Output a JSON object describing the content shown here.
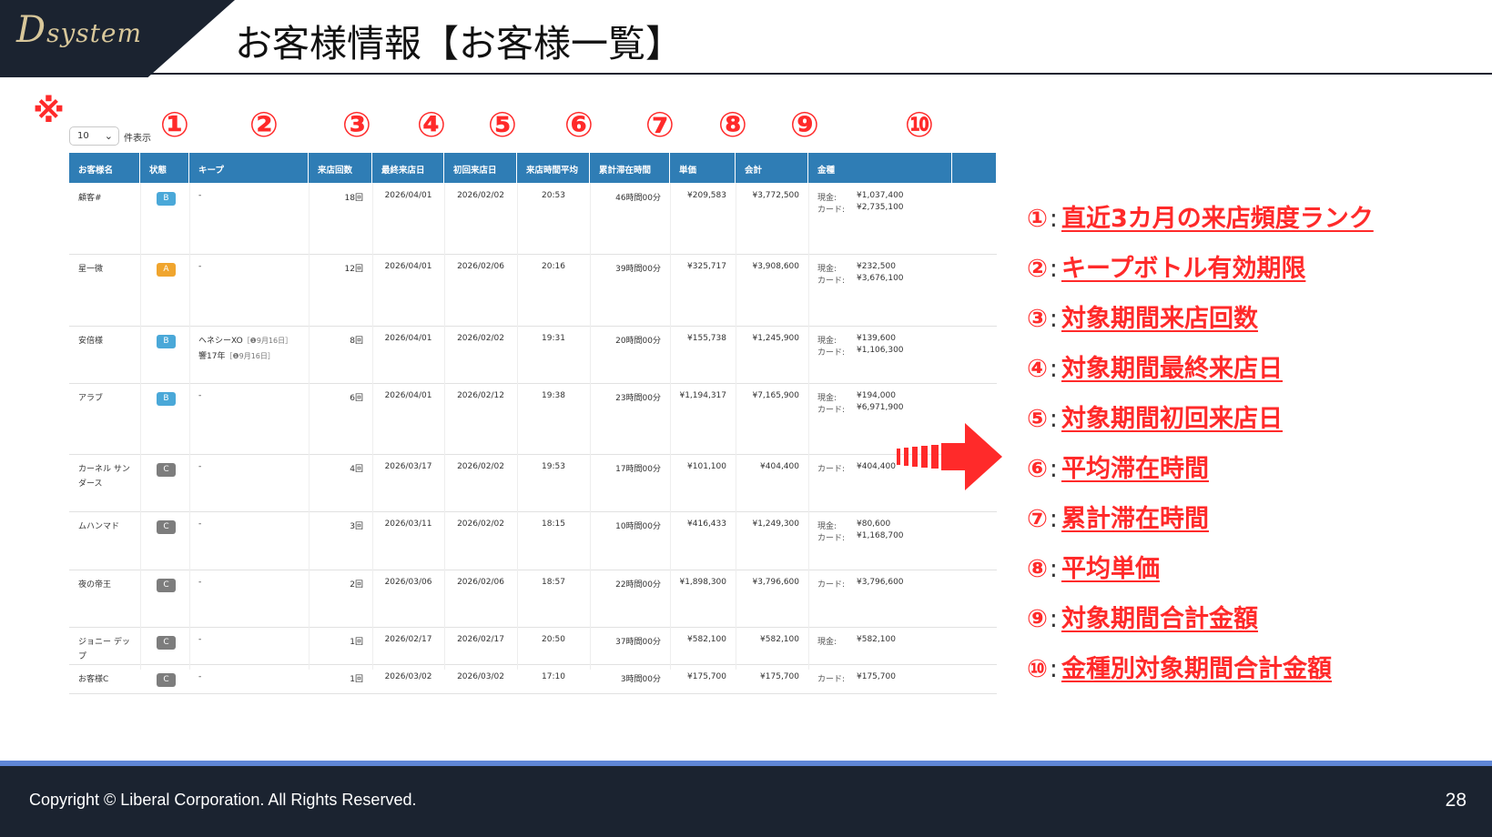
{
  "header": {
    "logo_main": "D",
    "logo_sub": "system",
    "title": "お客様情報【お客様一覧】"
  },
  "note_mark": "※",
  "col_markers": [
    "①",
    "②",
    "③",
    "④",
    "⑤",
    "⑥",
    "⑦",
    "⑧",
    "⑨",
    "⑩"
  ],
  "pager": {
    "value": "10",
    "label": "件表示"
  },
  "table": {
    "columns": [
      "お客様名",
      "状態",
      "キープ",
      "来店回数",
      "最終来店日",
      "初回来店日",
      "来店時間平均",
      "累計滞在時間",
      "単価",
      "会計",
      "金種"
    ],
    "rows": [
      {
        "name": "顧客#",
        "name2": "",
        "rank": "B",
        "keep": [
          "-"
        ],
        "keep_dates": [
          ""
        ],
        "visits": "18回",
        "last": "2026/04/01",
        "first": "2026/02/02",
        "avg_time": "20:53",
        "total_stay": "46時間00分",
        "unit": "¥209,583",
        "total": "¥3,772,500",
        "payments": [
          {
            "type": "現金:",
            "amount": "¥1,037,400"
          },
          {
            "type": "カード:",
            "amount": "¥2,735,100"
          }
        ]
      },
      {
        "name": "星一微",
        "name2": "",
        "rank": "A",
        "keep": [
          "-"
        ],
        "keep_dates": [
          ""
        ],
        "visits": "12回",
        "last": "2026/04/01",
        "first": "2026/02/06",
        "avg_time": "20:16",
        "total_stay": "39時間00分",
        "unit": "¥325,717",
        "total": "¥3,908,600",
        "payments": [
          {
            "type": "現金:",
            "amount": "¥232,500"
          },
          {
            "type": "カード:",
            "amount": "¥3,676,100"
          }
        ]
      },
      {
        "name": "安倍様",
        "name2": "",
        "rank": "B",
        "keep": [
          "ヘネシーXO",
          "響17年"
        ],
        "keep_dates": [
          "［❶9月16日］",
          "［❶9月16日］"
        ],
        "visits": "8回",
        "last": "2026/04/01",
        "first": "2026/02/02",
        "avg_time": "19:31",
        "total_stay": "20時間00分",
        "unit": "¥155,738",
        "total": "¥1,245,900",
        "payments": [
          {
            "type": "現金:",
            "amount": "¥139,600"
          },
          {
            "type": "カード:",
            "amount": "¥1,106,300"
          }
        ]
      },
      {
        "name": "アラブ",
        "name2": "",
        "rank": "B",
        "keep": [
          "-"
        ],
        "keep_dates": [
          ""
        ],
        "visits": "6回",
        "last": "2026/04/01",
        "first": "2026/02/12",
        "avg_time": "19:38",
        "total_stay": "23時間00分",
        "unit": "¥1,194,317",
        "total": "¥7,165,900",
        "payments": [
          {
            "type": "現金:",
            "amount": "¥194,000"
          },
          {
            "type": "カード:",
            "amount": "¥6,971,900"
          }
        ]
      },
      {
        "name": "カーネル サン",
        "name2": "ダース",
        "rank": "C",
        "keep": [
          "-"
        ],
        "keep_dates": [
          ""
        ],
        "visits": "4回",
        "last": "2026/03/17",
        "first": "2026/02/02",
        "avg_time": "19:53",
        "total_stay": "17時間00分",
        "unit": "¥101,100",
        "total": "¥404,400",
        "payments": [
          {
            "type": "カード:",
            "amount": "¥404,400"
          }
        ]
      },
      {
        "name": "ムハンマド",
        "name2": "",
        "rank": "C",
        "keep": [
          "-"
        ],
        "keep_dates": [
          ""
        ],
        "visits": "3回",
        "last": "2026/03/11",
        "first": "2026/02/02",
        "avg_time": "18:15",
        "total_stay": "10時間00分",
        "unit": "¥416,433",
        "total": "¥1,249,300",
        "payments": [
          {
            "type": "現金:",
            "amount": "¥80,600"
          },
          {
            "type": "カード:",
            "amount": "¥1,168,700"
          }
        ]
      },
      {
        "name": "夜の帝王",
        "name2": "",
        "rank": "C",
        "keep": [
          "-"
        ],
        "keep_dates": [
          ""
        ],
        "visits": "2回",
        "last": "2026/03/06",
        "first": "2026/02/06",
        "avg_time": "18:57",
        "total_stay": "22時間00分",
        "unit": "¥1,898,300",
        "total": "¥3,796,600",
        "payments": [
          {
            "type": "カード:",
            "amount": "¥3,796,600"
          }
        ]
      },
      {
        "name": "ジョニー デッ",
        "name2": "プ",
        "rank": "C",
        "keep": [
          "-"
        ],
        "keep_dates": [
          ""
        ],
        "visits": "1回",
        "last": "2026/02/17",
        "first": "2026/02/17",
        "avg_time": "20:50",
        "total_stay": "37時間00分",
        "unit": "¥582,100",
        "total": "¥582,100",
        "payments": [
          {
            "type": "現金:",
            "amount": "¥582,100"
          }
        ]
      },
      {
        "name": "お客様C",
        "name2": "",
        "rank": "C",
        "keep": [
          "-"
        ],
        "keep_dates": [
          ""
        ],
        "visits": "1回",
        "last": "2026/03/02",
        "first": "2026/03/02",
        "avg_time": "17:10",
        "total_stay": "3時間00分",
        "unit": "¥175,700",
        "total": "¥175,700",
        "payments": [
          {
            "type": "カード:",
            "amount": "¥175,700"
          }
        ]
      }
    ]
  },
  "legend": [
    {
      "num": "①",
      "colon": ":",
      "text": "直近3カ月の来店頻度ランク"
    },
    {
      "num": "②",
      "colon": ":",
      "text": "キープボトル有効期限"
    },
    {
      "num": "③",
      "colon": ":",
      "text": "対象期間来店回数"
    },
    {
      "num": "④",
      "colon": ":",
      "text": "対象期間最終来店日"
    },
    {
      "num": "⑤",
      "colon": ":",
      "text": "対象期間初回来店日"
    },
    {
      "num": "⑥",
      "colon": ":",
      "text": "平均滞在時間"
    },
    {
      "num": "⑦",
      "colon": ":",
      "text": "累計滞在時間"
    },
    {
      "num": "⑧",
      "colon": ":",
      "text": "平均単価"
    },
    {
      "num": "⑨",
      "colon": ":",
      "text": "対象期間合計金額"
    },
    {
      "num": "⑩",
      "colon": ":",
      "text": "金種別対象期間合計金額"
    }
  ],
  "colors": {
    "accent": "#ff2a2a",
    "table_header": "#2f7db5",
    "dark": "#1b2330",
    "footer_line": "#5f86d6",
    "rank_A": "#f0a52e",
    "rank_B": "#4aa8d8",
    "rank_C": "#7d7d7d"
  },
  "footer": {
    "copyright": "Copyright ©  Liberal Corporation. All Rights Reserved.",
    "page": "28"
  }
}
